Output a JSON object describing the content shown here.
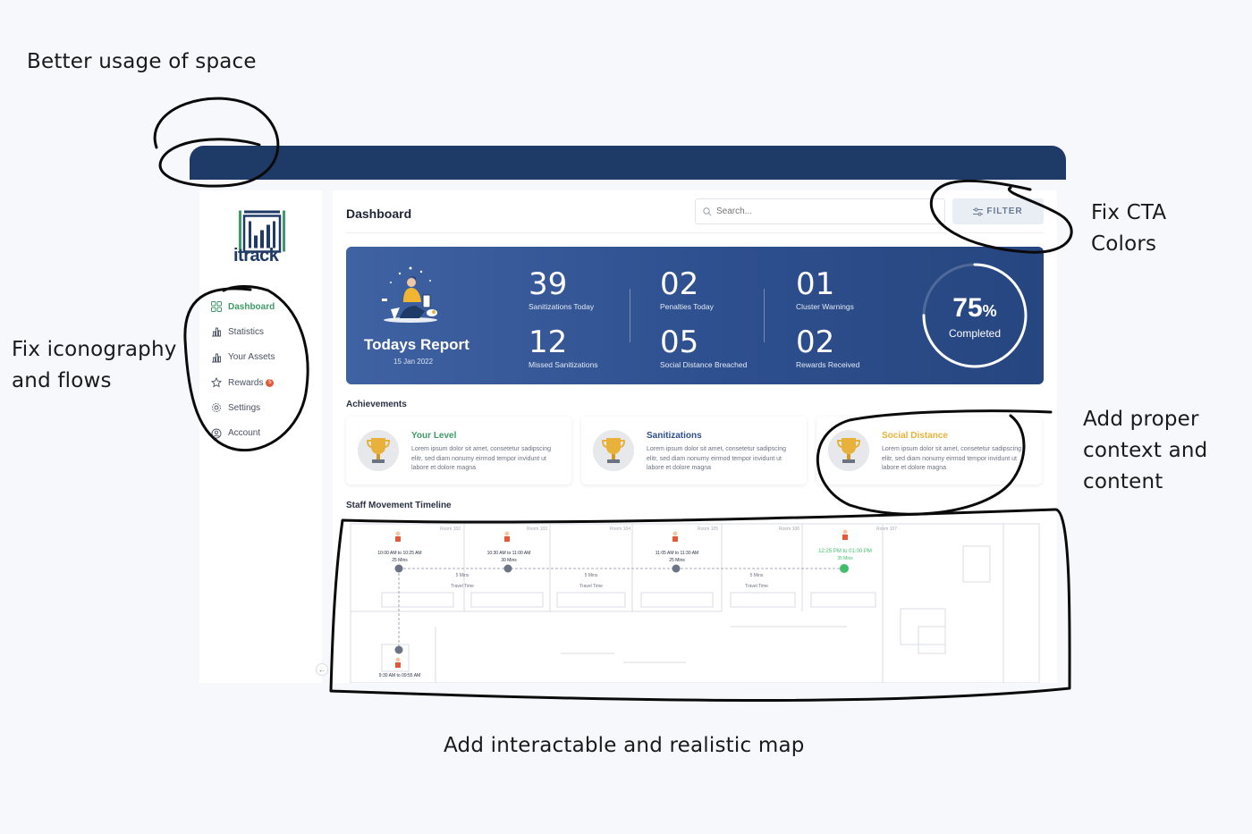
{
  "annotations": {
    "space": "Better usage of space",
    "cta": [
      "Fix CTA",
      "Colors"
    ],
    "iconography": [
      "Fix iconography",
      "and flows"
    ],
    "context": [
      "Add proper",
      "context and",
      "content"
    ],
    "map": "Add interactable and realistic map"
  },
  "brand": {
    "name": "itrack",
    "color": "#1e3a66",
    "accent": "#3f9a66"
  },
  "sidebar": {
    "items": [
      {
        "label": "Dashboard",
        "icon": "grid-icon",
        "active": true
      },
      {
        "label": "Statistics",
        "icon": "chart-icon"
      },
      {
        "label": "Your Assets",
        "icon": "assets-icon"
      },
      {
        "label": "Rewards",
        "icon": "star-icon",
        "badge": "5"
      },
      {
        "label": "Settings",
        "icon": "gear-icon"
      },
      {
        "label": "Account",
        "icon": "user-icon"
      }
    ],
    "collapse_icon": "arrow-left-icon"
  },
  "header": {
    "title": "Dashboard",
    "search_placeholder": "Search...",
    "filter_label": "FILTER"
  },
  "report": {
    "title": "Todays Report",
    "date": "15 Jan 2022",
    "stats": [
      {
        "value": "39",
        "label": "Sanitizations Today"
      },
      {
        "value": "12",
        "label": "Missed Sanitizations"
      },
      {
        "value": "02",
        "label": "Penalties Today"
      },
      {
        "value": "05",
        "label": "Social Distance Breached"
      },
      {
        "value": "01",
        "label": "Cluster Warnings"
      },
      {
        "value": "02",
        "label": "Rewards Received"
      }
    ],
    "progress": {
      "percent": 75,
      "value": "75",
      "unit": "%",
      "label": "Completed"
    }
  },
  "achievements": {
    "title": "Achievements",
    "cards": [
      {
        "title": "Your Level",
        "color": "#3f9a66",
        "desc": "Lorem ipsum dolor sit amet, consetetur sadipscing elitr, sed diam nonumy eirmod tempor invidunt ut labore et dolore magna"
      },
      {
        "title": "Sanitizations",
        "color": "#2e4f8e",
        "desc": "Lorem ipsum dolor sit amet, consetetur sadipscing elitr, sed diam nonumy eirmod tempor invidunt ut labore et dolore magna"
      },
      {
        "title": "Social Distance",
        "color": "#e8b23a",
        "desc": "Lorem ipsum dolor sit amet, consetetur sadipscing elitr, sed diam nonumy eirmod tempor invidunt ut labore et dolore magna"
      }
    ]
  },
  "timeline": {
    "title": "Staff Movement Timeline",
    "rooms": [
      "Room 102",
      "Room 103",
      "Room 104",
      "Room 105",
      "Room 106",
      "Room 107"
    ],
    "stops": [
      {
        "time": "10:00 AM to 10:25 AM",
        "duration": "25 Mins"
      },
      {
        "time": "10:30 AM to 11:00 AM",
        "duration": "30 Mins"
      },
      {
        "time": "11:05 AM to 11:30 AM",
        "duration": "25 Mins"
      },
      {
        "time": "12:25 PM to 01:00 PM",
        "duration": "35 Mins",
        "current": true
      }
    ],
    "travels": [
      {
        "time": "5 Mins",
        "label": "Travel Time"
      },
      {
        "time": "5 Mins",
        "label": "Travel Time"
      },
      {
        "time": "5 Mins",
        "label": "Travel Time"
      }
    ],
    "start": {
      "time": "9:30 AM to 09:55 AM"
    }
  }
}
